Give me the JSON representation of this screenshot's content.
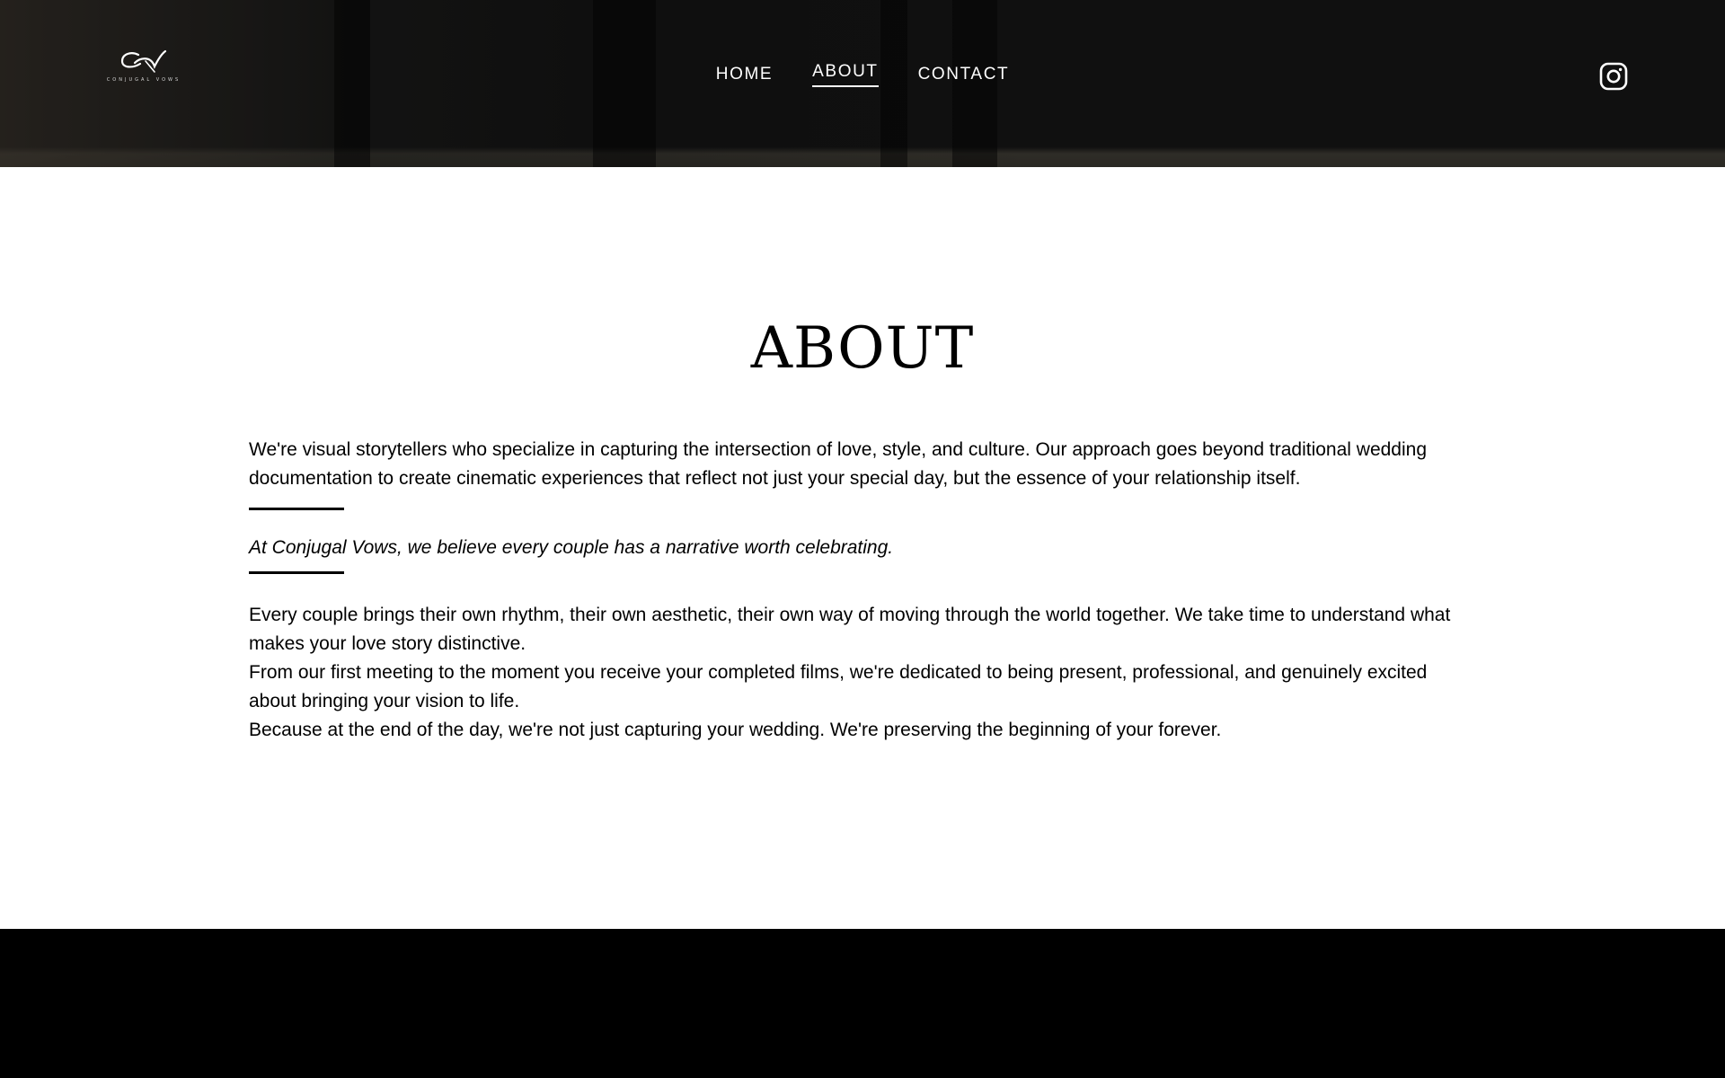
{
  "header": {
    "logo": {
      "mark": "CV",
      "subtitle": "CONJUGAL VOWS"
    },
    "nav": [
      {
        "label": "HOME",
        "active": false
      },
      {
        "label": "ABOUT",
        "active": true
      },
      {
        "label": "CONTACT",
        "active": false
      }
    ],
    "social_icon": "instagram-icon"
  },
  "main": {
    "title": "ABOUT",
    "intro": "We're visual storytellers who specialize in capturing the intersection of love, style, and culture. Our approach goes beyond traditional wedding documentation to create cinematic experiences that reflect not just your special day, but the essence of your relationship itself.",
    "quote": "At Conjugal Vows, we believe every couple has a narrative worth celebrating.",
    "paragraphs": [
      "Every couple brings their own rhythm, their own aesthetic, their own way of moving through the world together. We take time to understand what makes your love story distinctive.",
      "From our first meeting to the moment you receive your completed films, we're dedicated to being present, professional, and genuinely excited about bringing your vision to life.",
      "Because at the end of the day, we're not just capturing your wedding. We're preserving the beginning of your forever."
    ]
  },
  "colors": {
    "header_bg": "#141414",
    "text": "#000000",
    "footer_bg": "#000000",
    "nav_text": "#ffffff"
  }
}
